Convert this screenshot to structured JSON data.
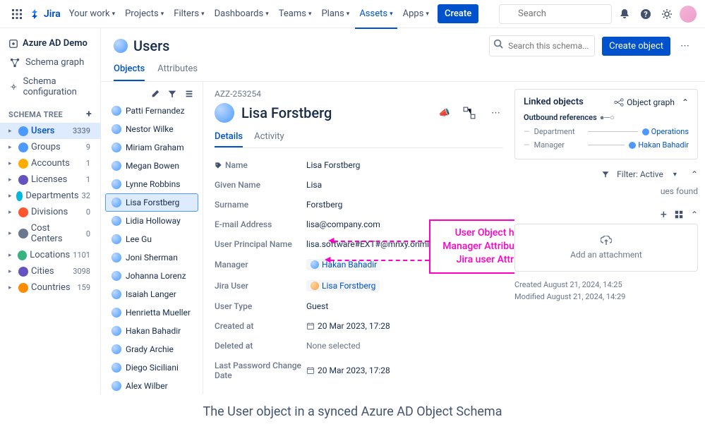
{
  "nav": {
    "logo": "Jira",
    "items": [
      "Your work",
      "Projects",
      "Filters",
      "Dashboards",
      "Teams",
      "Plans",
      "Assets",
      "Apps"
    ],
    "active_index": 6,
    "create": "Create",
    "search_placeholder": "Search"
  },
  "sidebar": {
    "schema_name": "Azure AD Demo",
    "links": {
      "graph": "Schema graph",
      "config": "Schema configuration"
    },
    "section": "SCHEMA TREE",
    "tree": [
      {
        "label": "Users",
        "count": "3339",
        "sel": true,
        "color": "#4c9aff"
      },
      {
        "label": "Groups",
        "count": "9",
        "color": "#4c9aff"
      },
      {
        "label": "Accounts",
        "count": "1",
        "color": "#ffab00"
      },
      {
        "label": "Licenses",
        "count": "1",
        "color": "#6554c0"
      },
      {
        "label": "Departments",
        "count": "32",
        "color": "#00b8d9"
      },
      {
        "label": "Divisions",
        "count": "0",
        "color": "#ff5630"
      },
      {
        "label": "Cost Centers",
        "count": "0",
        "color": "#6b778c"
      },
      {
        "label": "Locations",
        "count": "1101",
        "color": "#36b37e"
      },
      {
        "label": "Cities",
        "count": "3098",
        "color": "#6554c0"
      },
      {
        "label": "Countries",
        "count": "159",
        "color": "#ff8b00"
      }
    ]
  },
  "page": {
    "title": "Users",
    "search_placeholder": "Search this schema...",
    "create_object": "Create object",
    "tabs": {
      "objects": "Objects",
      "attributes": "Attributes"
    }
  },
  "object_list": [
    "Patti Fernandez",
    "Nestor Wilke",
    "Miriam Graham",
    "Megan Bowen",
    "Lynne Robbins",
    "Lisa Forstberg",
    "Lidia Holloway",
    "Lee Gu",
    "Joni Sherman",
    "Johanna Lorenz",
    "Isaiah Langer",
    "Henrietta Mueller",
    "Hakan Bahadir",
    "Grady Archie",
    "Diego Siciliani",
    "Alex Wilber"
  ],
  "object_list_selected": 5,
  "detail": {
    "key": "AZZ-253254",
    "name": "Lisa Forstberg",
    "tabs": {
      "details": "Details",
      "activity": "Activity"
    },
    "attributes": [
      {
        "k": "Name",
        "v": "Lisa Forstberg",
        "icon": "label"
      },
      {
        "k": "Given Name",
        "v": "Lisa"
      },
      {
        "k": "Surname",
        "v": "Forstberg"
      },
      {
        "k": "E-mail Address",
        "v": "lisa@company.com"
      },
      {
        "k": "User Principal Name",
        "v": "lisa.software#EXT#@mnxy.onmicrosoft.com"
      },
      {
        "k": "Manager",
        "v": "Hakan Bahadir",
        "chip": true,
        "avb": true
      },
      {
        "k": "Jira User",
        "v": "Lisa Forstberg",
        "chip": true,
        "av": true
      },
      {
        "k": "User Type",
        "v": "Guest"
      },
      {
        "k": "Created at",
        "v": "20 Mar 2023, 17:28",
        "cal": true
      },
      {
        "k": "Deleted at",
        "v": "None selected",
        "muted": true
      },
      {
        "k": "Last Password Change Date",
        "v": "20 Mar 2023, 17:28",
        "cal": true
      }
    ]
  },
  "linked": {
    "title": "Linked objects",
    "graph_btn": "Object graph",
    "outbound": "Outbound references",
    "refs": [
      {
        "label": "Department",
        "target": "Operations"
      },
      {
        "label": "Manager",
        "target": "Hakan Bahadir"
      }
    ]
  },
  "issues": {
    "filter": "Filter: Active",
    "empty": "ues found"
  },
  "attachments": {
    "add": "Add an attachment"
  },
  "timestamps": {
    "created": "Created August 21, 2024, 14:25",
    "modified": "Modified August 21, 2024, 14:29"
  },
  "annotation": "User Object have a Manager Attribute and a Jira user Attribute",
  "caption": "The User object in a synced Azure AD Object Schema"
}
